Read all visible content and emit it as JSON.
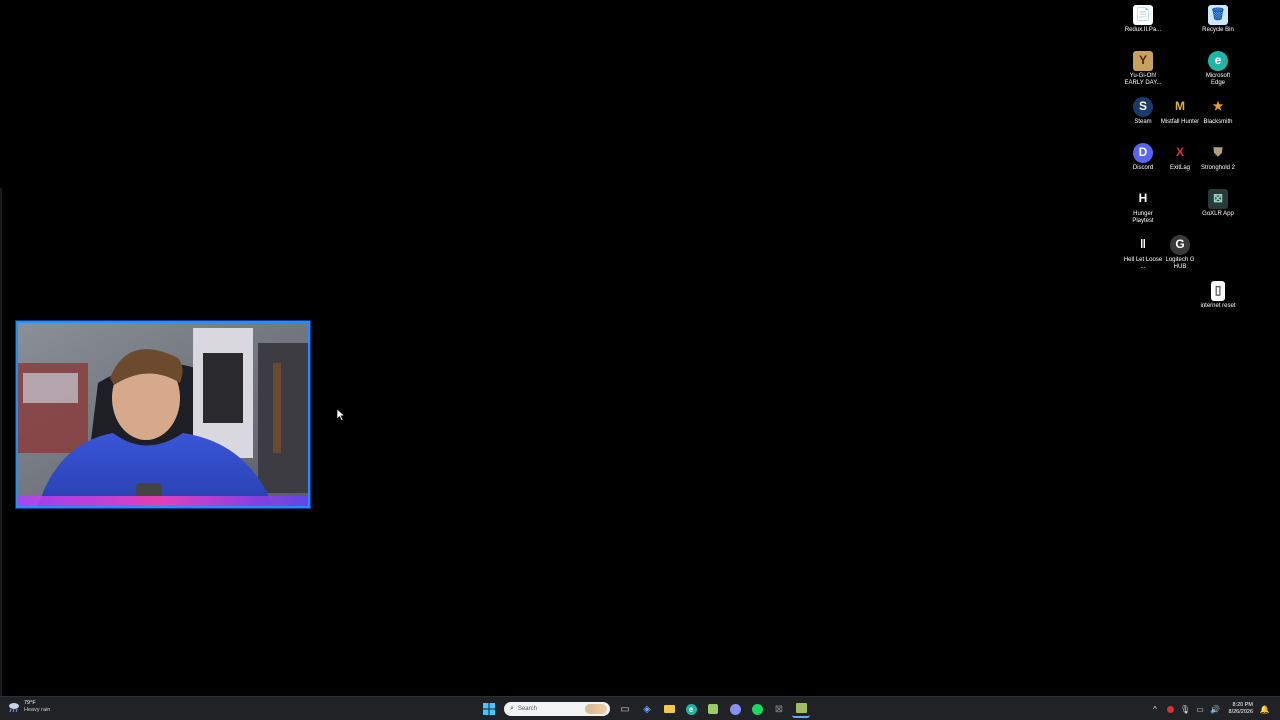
{
  "desktop_icons": [
    {
      "name": "redux-file-icon",
      "label": "Redux.II.Pa...",
      "glyph": "📄",
      "bg": "#ffffff",
      "fg": "#333333"
    },
    {
      "name": "recycle-bin-icon",
      "label": "Recycle Bin",
      "glyph": "🗑",
      "bg": "#cfe6ff",
      "fg": "#1a5fb4"
    },
    {
      "name": "yugioh-icon",
      "label": "Yu-Gi-Oh! EARLY DAY...",
      "glyph": "Y",
      "bg": "#c8a060",
      "fg": "#4a2a00"
    },
    {
      "name": "edge-icon",
      "label": "Microsoft Edge",
      "glyph": "e",
      "bg": "#1fb6a8",
      "fg": "#ffffff"
    },
    {
      "name": "steam-icon",
      "label": "Steam",
      "glyph": "S",
      "bg": "#1b3a6b",
      "fg": "#ffffff"
    },
    {
      "name": "mistfall-icon",
      "label": "Mistfall Hunter",
      "glyph": "M",
      "bg": "#000000",
      "fg": "#e0b040"
    },
    {
      "name": "blacksmith-icon",
      "label": "Blacksmith",
      "glyph": "★",
      "bg": "#000000",
      "fg": "#f0a020"
    },
    {
      "name": "discord-icon",
      "label": "Discord",
      "glyph": "D",
      "bg": "#5865f2",
      "fg": "#ffffff"
    },
    {
      "name": "exitlag-icon",
      "label": "ExitLag",
      "glyph": "X",
      "bg": "#000000",
      "fg": "#e03030"
    },
    {
      "name": "stronghold-icon",
      "label": "Stronghold 2",
      "glyph": "⛊",
      "bg": "#000000",
      "fg": "#b0a080"
    },
    {
      "name": "hunger-icon",
      "label": "Hunger Playtest",
      "glyph": "H",
      "bg": "#000000",
      "fg": "#ffffff"
    },
    {
      "name": "goxlr-icon",
      "label": "GoXLR App",
      "glyph": "⊠",
      "bg": "#2a3a3a",
      "fg": "#9ad0c0"
    },
    {
      "name": "hell-let-loose-icon",
      "label": "Hell Let Loose ...",
      "glyph": "‖",
      "bg": "#000000",
      "fg": "#ffffff"
    },
    {
      "name": "logitech-icon",
      "label": "Logitech G HUB",
      "glyph": "G",
      "bg": "#3a3a3a",
      "fg": "#ffffff"
    },
    {
      "name": "internet-reset-icon",
      "label": "internet reset",
      "glyph": "▯",
      "bg": "#ffffff",
      "fg": "#555555"
    }
  ],
  "weather": {
    "temp": "79°F",
    "condition": "Heavy rain"
  },
  "search": {
    "placeholder": "Search"
  },
  "taskbar_apps": [
    {
      "name": "windows-start-icon",
      "glyph": "⊞",
      "color": "#4cc2ff"
    },
    {
      "name": "task-view-icon",
      "glyph": "▭",
      "color": "#cccccc"
    },
    {
      "name": "widgets-icon",
      "glyph": "◈",
      "color": "#6aa8ff"
    },
    {
      "name": "file-explorer-icon",
      "glyph": "▬",
      "color": "#f2c94c"
    },
    {
      "name": "edge-taskbar-icon",
      "glyph": "e",
      "color": "#1fb6a8"
    },
    {
      "name": "store-icon",
      "glyph": "◧",
      "color": "#9ccc65"
    },
    {
      "name": "discord-taskbar-icon",
      "glyph": "◍",
      "color": "#8891f2"
    },
    {
      "name": "spotify-icon",
      "glyph": "●",
      "color": "#1ed760"
    },
    {
      "name": "goxlr-taskbar-icon",
      "glyph": "⊠",
      "color": "#888888"
    },
    {
      "name": "game-taskbar-icon",
      "glyph": "▦",
      "color": "#a0c060"
    }
  ],
  "tray": {
    "chevron": "^",
    "time": "8:20 PM",
    "date": "8/26/2026"
  }
}
